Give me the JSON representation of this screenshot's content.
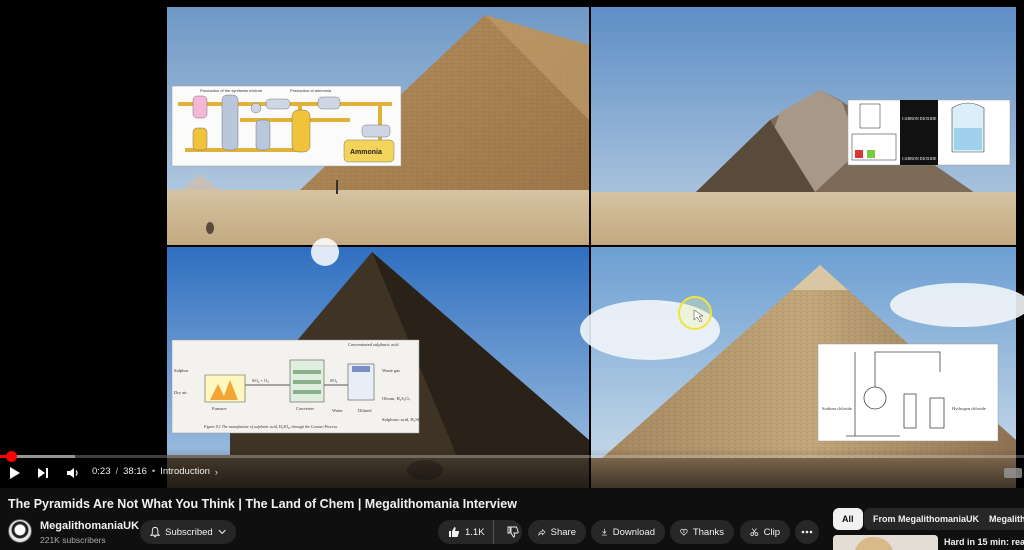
{
  "player": {
    "current_time": "0:23",
    "time_separator": "/",
    "duration": "38:16",
    "bullet": "•",
    "chapter": "Introduction",
    "chapter_chevron": "›",
    "progress_fraction": 0.011,
    "buffer_fraction": 0.073,
    "progress_color": "#ff0000",
    "icons": [
      "play-icon",
      "next-icon",
      "volume-icon",
      "captions-icon",
      "cursor-highlight-icon"
    ]
  },
  "video": {
    "title": "The Pyramids Are Not What You Think | The Land of Chem | Megalithomania Interview"
  },
  "frame_content": {
    "panel_1_diagram": {
      "title_left": "Production of the synthesis mixture",
      "title_right": "Production of ammonia",
      "result_label": "Ammonia"
    },
    "panel_2_diagram": {
      "label_top": "CARBON DIOXIDE",
      "label_bottom": "CARBON DIOXIDE"
    },
    "panel_3_diagram": {
      "label_sulphur": "Sulphur",
      "label_dry_air": "Dry air",
      "label_furnace": "Furnace",
      "label_reaction": "SO₂ + O₂",
      "label_converter": "Converter",
      "label_so3": "SO₃",
      "label_conc_acid": "Concentrated sulphuric acid",
      "label_waste_gas": "Waste gas",
      "label_water": "Water",
      "label_oleum": "Oleum, H₂S₂O₇",
      "label_dilute": "Diluted",
      "label_product": "Sulphuric acid, H₂SO₄",
      "caption": "Figure 9.1  The manufacture of sulphuric acid, H₂SO₄, through the Contact Process"
    },
    "panel_4_diagram": {
      "label_sodium_chloride": "Sodium chloride",
      "label_hydrogen_chloride": "Hydrogen chloride"
    }
  },
  "channel": {
    "name": "MegalithomaniaUK",
    "subscribers": "221K subscribers"
  },
  "actions": {
    "subscribed_label": "Subscribed",
    "like_count": "1.1K",
    "share_label": "Share",
    "download_label": "Download",
    "thanks_label": "Thanks",
    "clip_label": "Clip"
  },
  "sidebar": {
    "chips": [
      "All",
      "From MegalithomaniaUK",
      "Megalith"
    ],
    "recommendation": {
      "title": "Hard in 15 min: read"
    }
  }
}
